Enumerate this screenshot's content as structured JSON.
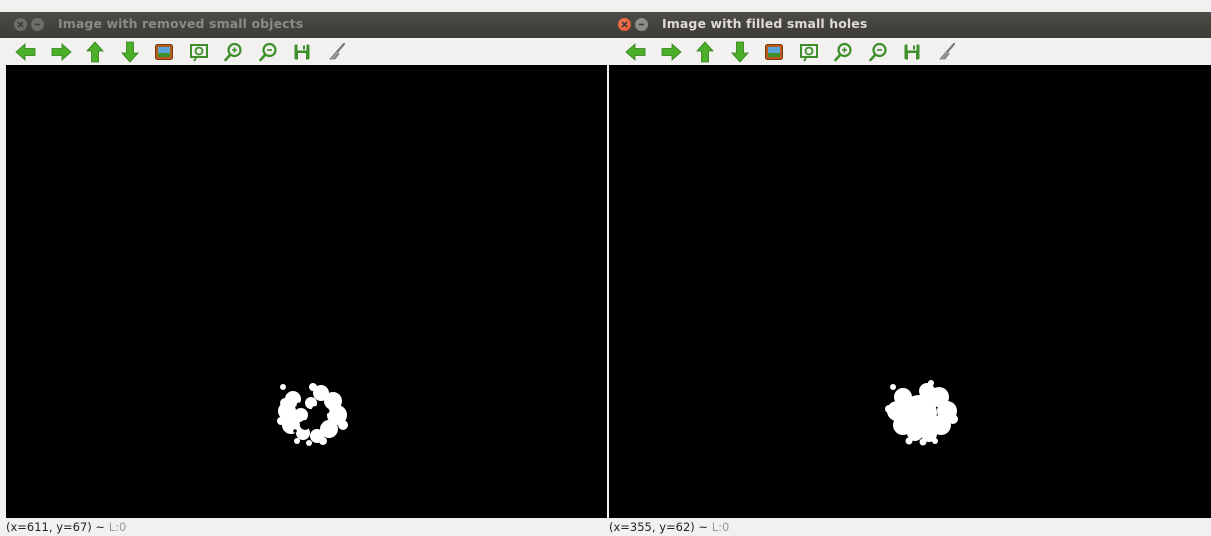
{
  "windows": [
    {
      "title": "Image with removed small objects",
      "status_coords": "(x=611, y=67)",
      "status_sep": " ~ ",
      "status_level": "L:0"
    },
    {
      "title": "Image with filled small holes",
      "status_coords": "(x=355, y=62)",
      "status_sep": " ~ ",
      "status_level": "L:0"
    }
  ],
  "toolbar_icons": [
    "arrow-left-icon",
    "arrow-right-icon",
    "arrow-up-icon",
    "arrow-down-icon",
    "image-icon",
    "zoom-fit-icon",
    "zoom-in-icon",
    "zoom-out-icon",
    "save-icon",
    "properties-icon"
  ],
  "colors": {
    "accent_green": "#4caf2a",
    "canvas_background": "#000000",
    "blob": "#ffffff",
    "titlebar": "#3c3b37",
    "close_active": "#e2502a"
  }
}
